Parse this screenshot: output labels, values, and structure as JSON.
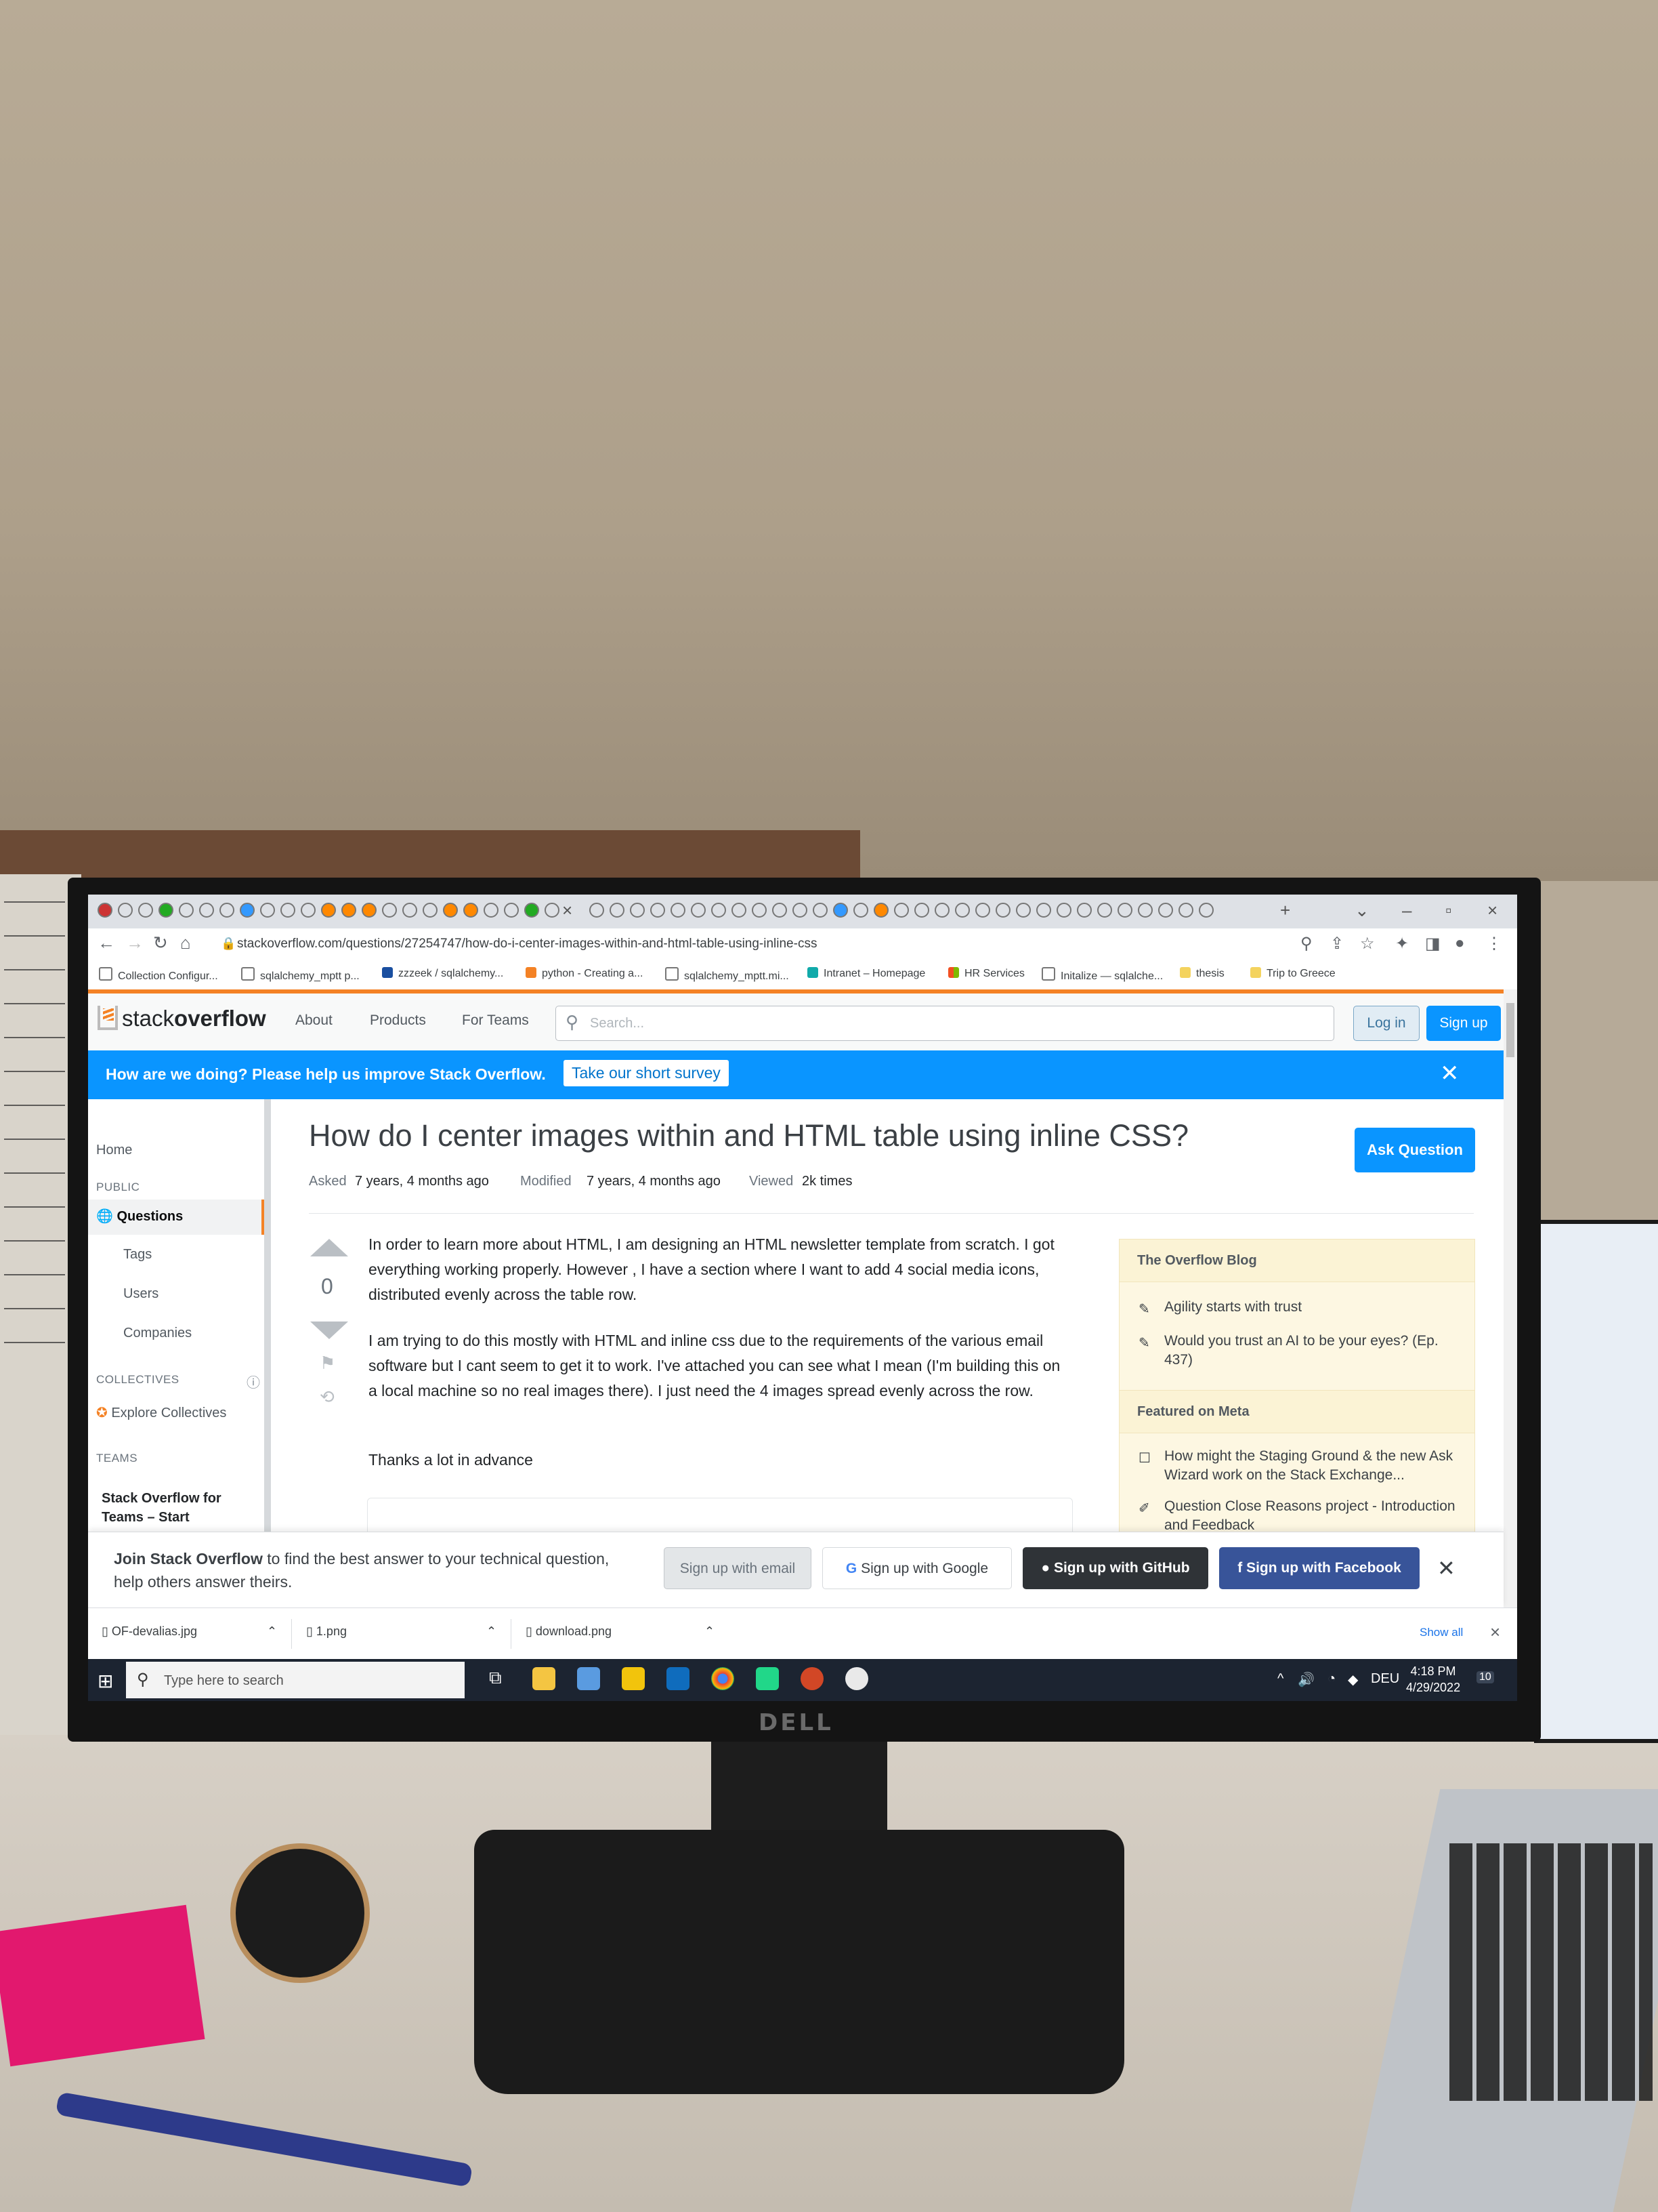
{
  "browser": {
    "url": "stackoverflow.com/questions/27254747/how-do-i-center-images-within-and-html-table-using-inline-css",
    "bookmarks": [
      "Collection Configur...",
      "sqlalchemy_mptt p...",
      "zzzeek / sqlalchemy...",
      "python - Creating a...",
      "sqlalchemy_mptt.mi...",
      "Intranet – Homepage",
      "HR Services",
      "Initalize — sqlalche...",
      "thesis",
      "Trip to Greece"
    ]
  },
  "so": {
    "logo_text": "stack",
    "logo_bold": "overflow",
    "nav": [
      "About",
      "Products",
      "For Teams"
    ],
    "search_placeholder": "Search...",
    "login": "Log in",
    "signup": "Sign up",
    "survey_text": "How are we doing? Please help us improve Stack Overflow.",
    "survey_link": "Take our short survey"
  },
  "leftnav": {
    "home": "Home",
    "public": "PUBLIC",
    "questions": "Questions",
    "tags": "Tags",
    "users": "Users",
    "companies": "Companies",
    "collectives": "COLLECTIVES",
    "explore": "Explore Collectives",
    "teams": "TEAMS",
    "teams_item": "Stack Overflow for",
    "teams_item2": "Teams – Start"
  },
  "question": {
    "title": "How do I center images within and HTML table using inline CSS?",
    "ask_button": "Ask Question",
    "asked_label": "Asked",
    "asked": "7 years, 4 months ago",
    "modified_label": "Modified",
    "modified": "7 years, 4 months ago",
    "viewed_label": "Viewed",
    "viewed": "2k times",
    "votes": "0",
    "p1": "In order to learn more about HTML, I am designing an HTML newsletter template from scratch. I got everything working properly. However , I have a section where I want to add 4 social media icons, distributed evenly across the table row.",
    "p2": "I am trying to do this mostly with HTML and inline css due to the requirements of the various email software but I cant seem to get it to work. I've attached you can see what I mean (I'm building this on a local machine so no real images there). I just need the 4 images spread evenly across the row.",
    "p3": "Thanks a lot in advance"
  },
  "sidebar": {
    "blog_title": "The Overflow Blog",
    "blog_items": [
      "Agility starts with trust",
      "Would you trust an AI to be your eyes? (Ep. 437)"
    ],
    "meta_title": "Featured on Meta",
    "meta_items": [
      "How might the Staging Ground & the new Ask Wizard work on the Stack Exchange...",
      "Question Close Reasons project - Introduction and Feedback"
    ]
  },
  "join": {
    "bold": "Join Stack Overflow",
    "text": " to find the best answer to your technical question, help others answer theirs.",
    "email": "Sign up with email",
    "google": "Sign up with Google",
    "github": "Sign up with GitHub",
    "facebook": "Sign up with Facebook"
  },
  "downloads": {
    "items": [
      "OF-devalias.jpg",
      "1.png",
      "download.png"
    ],
    "show_all": "Show all"
  },
  "taskbar": {
    "search": "Type here to search",
    "lang": "DEU",
    "time": "4:18 PM",
    "date": "4/29/2022",
    "notifications": "10"
  },
  "monitor_brand": "DELL"
}
